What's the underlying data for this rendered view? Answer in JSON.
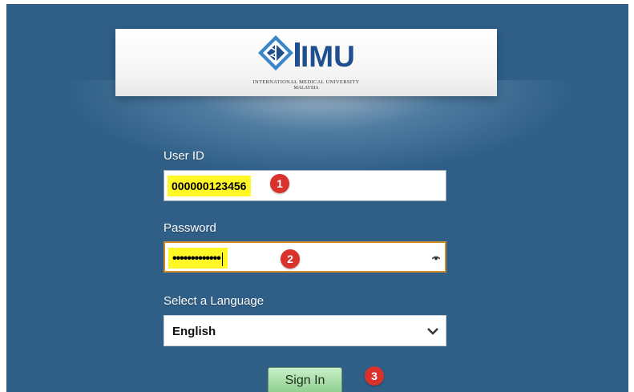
{
  "brand": {
    "logo_text": "IMU",
    "name": "INTERNATIONAL MEDICAL UNIVERSITY",
    "country": "MALAYSIA",
    "colors": {
      "navy": "#1f4f8f",
      "light_blue": "#3b86c6"
    }
  },
  "colors": {
    "background": "#2f5f87",
    "highlight": "#fff826",
    "focus_border": "#d18a2b",
    "badge": "#d9312b",
    "button_green": "#8fd08f"
  },
  "form": {
    "user_id": {
      "label": "User ID",
      "value": "000000123456"
    },
    "password": {
      "label": "Password",
      "masked_value": "•••••••••••••",
      "reveal_icon": "eye-icon"
    },
    "language": {
      "label": "Select a Language",
      "selected": "English",
      "dropdown_icon": "chevron-down-icon"
    },
    "submit_label": "Sign In"
  },
  "annotations": {
    "step1": "1",
    "step2": "2",
    "step3": "3"
  }
}
